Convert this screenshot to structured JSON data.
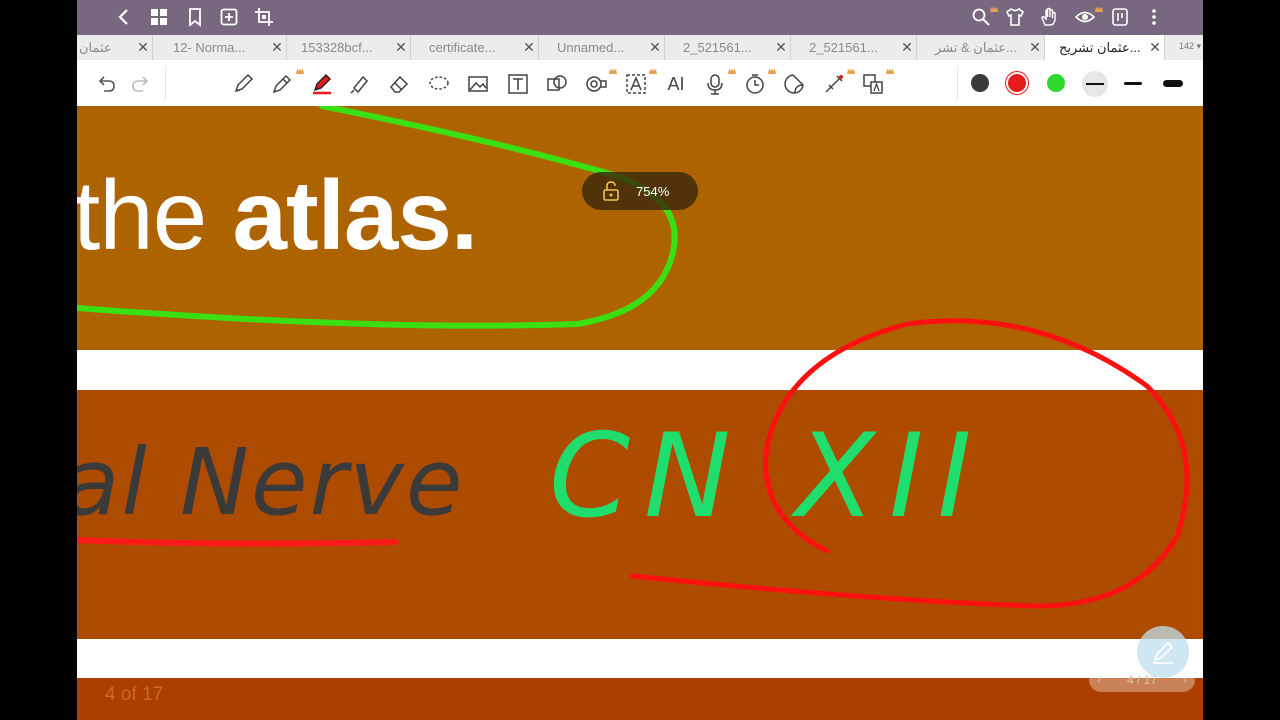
{
  "topbar": {
    "back": "back-icon",
    "icons_left": [
      "grid-icon",
      "bookmark-icon",
      "add-page-icon",
      "crop-icon"
    ],
    "icons_right": [
      "search-icon",
      "shirt-icon",
      "hand-icon",
      "eye-icon",
      "phone-icon",
      "more-icon"
    ]
  },
  "tabs": [
    {
      "label": "عثمان"
    },
    {
      "label": "12- Norma..."
    },
    {
      "label": "153328bcf..."
    },
    {
      "label": "certificate..."
    },
    {
      "label": "Unnamed..."
    },
    {
      "label": "2_521561..."
    },
    {
      "label": "2_521561..."
    },
    {
      "label": "عثمان & تشر..."
    },
    {
      "label": "عثمان تشريح...",
      "active": true
    }
  ],
  "tab_count": "142",
  "toolbar": {
    "tools": [
      "undo-icon",
      "redo-icon",
      "pen-icon",
      "pencil-icon",
      "marker-icon",
      "highlighter-icon",
      "eraser-icon",
      "lasso-icon",
      "image-icon",
      "text-icon",
      "shapes-icon",
      "tape-icon",
      "text-recognition-icon",
      "ai-icon",
      "microphone-icon",
      "timer-icon",
      "sticker-icon",
      "laser-icon",
      "translate-icon"
    ],
    "ai_label": "AI",
    "colors": [
      "#3a3a3a",
      "#e61c1c",
      "#2fd82f"
    ]
  },
  "slide": {
    "title_normal": "the ",
    "title_bold": "atlas.",
    "footer": "4 of 17",
    "ink_text_1": "al Nerve",
    "ink_text_2": "CN XII"
  },
  "zoom": {
    "label": "754%"
  },
  "page_nav": {
    "label": "4 / 17",
    "prev": "‹",
    "next": "›"
  }
}
